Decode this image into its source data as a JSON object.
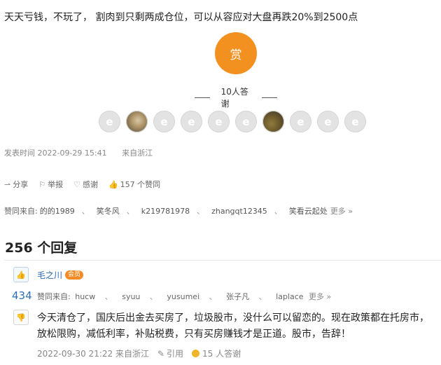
{
  "post": {
    "text": "天天亏钱，不玩了， 割肉到只剩两成仓位，可以从容应对大盘再跌20%到2500点",
    "reward_label": "赏",
    "thanks_label": "10人答谢",
    "avatars": [
      {
        "name": "default-avatar",
        "glyph": "e"
      },
      {
        "name": "photo-avatar",
        "glyph": ""
      },
      {
        "name": "default-avatar",
        "glyph": "e"
      },
      {
        "name": "default-avatar",
        "glyph": "e"
      },
      {
        "name": "default-avatar",
        "glyph": "e"
      },
      {
        "name": "default-avatar",
        "glyph": "e"
      },
      {
        "name": "photo-avatar",
        "glyph": ""
      },
      {
        "name": "default-avatar",
        "glyph": "e"
      },
      {
        "name": "default-avatar",
        "glyph": "e"
      },
      {
        "name": "default-avatar",
        "glyph": "e"
      }
    ],
    "publish_time": "发表时间 2022-09-29 15:41",
    "location": "来自浙江",
    "actions": {
      "share": "分享",
      "report": "举报",
      "thanks": "感谢",
      "likes": "157 个赞同"
    },
    "support": {
      "label": "赞同来自:",
      "names": [
        "的的1989",
        "笑冬风",
        "k219781978",
        "zhangqt12345",
        "笑看云起处"
      ],
      "more": "更多 »"
    }
  },
  "replies": {
    "title": "256 个回复",
    "items": [
      {
        "username": "毛之川",
        "badge": "会员",
        "vote_count": "434",
        "support_label": "赞同来自:",
        "support_names": [
          "hucw",
          "syuu",
          "yusumei",
          "张子凡",
          "laplace"
        ],
        "support_more": "更多 »",
        "text": "今天清仓了，国庆后出金去买房了，垃圾股市，没什么可以留恋的。现在政策都在托房市，放松限购，减低利率，补贴税费，只有买房赚钱才是正道。股市，告辞！",
        "time": "2022-09-30 21:22 来自浙江",
        "quote": "引用",
        "thanks": "15 人答谢"
      }
    ]
  },
  "colors": {
    "accent": "#f39120",
    "link": "#2c6ab0"
  }
}
